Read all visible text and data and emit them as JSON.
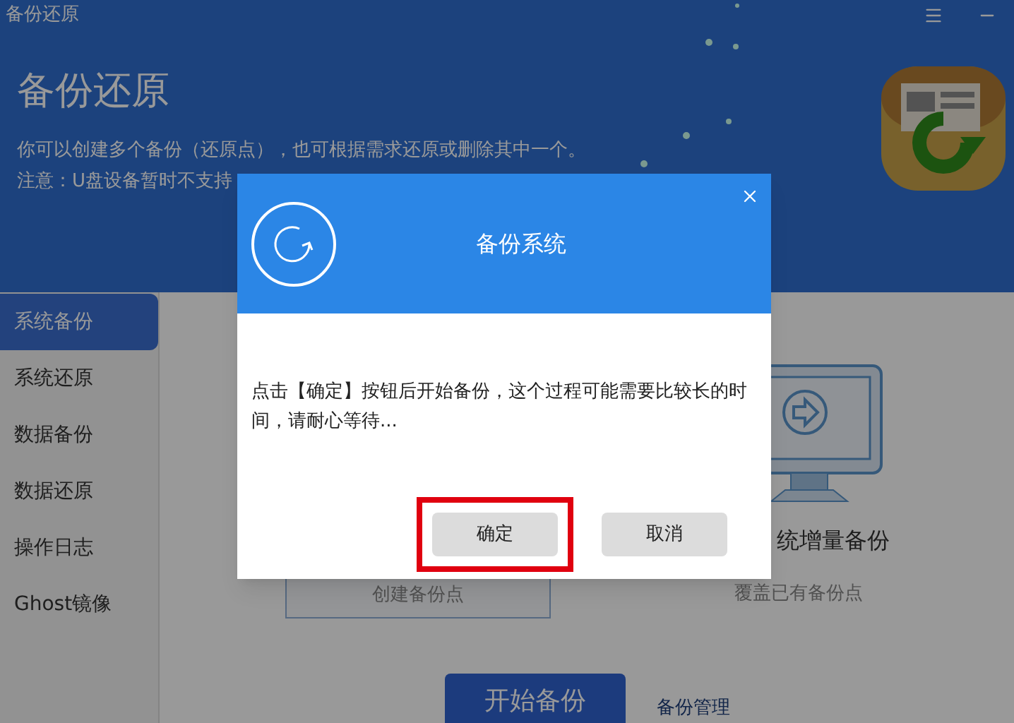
{
  "window": {
    "title": "备份还原"
  },
  "header": {
    "heading": "备份还原",
    "lines": [
      "你可以创建多个备份（还原点），也可根据需求还原或删除其中一个。",
      "注意：U盘设备暂时不支持"
    ]
  },
  "sidebar": {
    "items": [
      {
        "label": "系统备份",
        "selected": true
      },
      {
        "label": "系统还原",
        "selected": false
      },
      {
        "label": "数据备份",
        "selected": false
      },
      {
        "label": "数据还原",
        "selected": false
      },
      {
        "label": "操作日志",
        "selected": false
      },
      {
        "label": "Ghost镜像",
        "selected": false
      }
    ]
  },
  "options": [
    {
      "kind": "card",
      "subtitle": "创建备份点"
    },
    {
      "kind": "monitor",
      "title": "统增量备份",
      "subtitle": "覆盖已有备份点"
    }
  ],
  "actions": {
    "primary": "开始备份",
    "link": "备份管理"
  },
  "dialog": {
    "title": "备份系统",
    "message": "点击【确定】按钮后开始备份，这个过程可能需要比较长的时间，请耐心等待...",
    "buttons": [
      {
        "label": "确定",
        "highlighted": true
      },
      {
        "label": "取消",
        "highlighted": false
      }
    ]
  }
}
